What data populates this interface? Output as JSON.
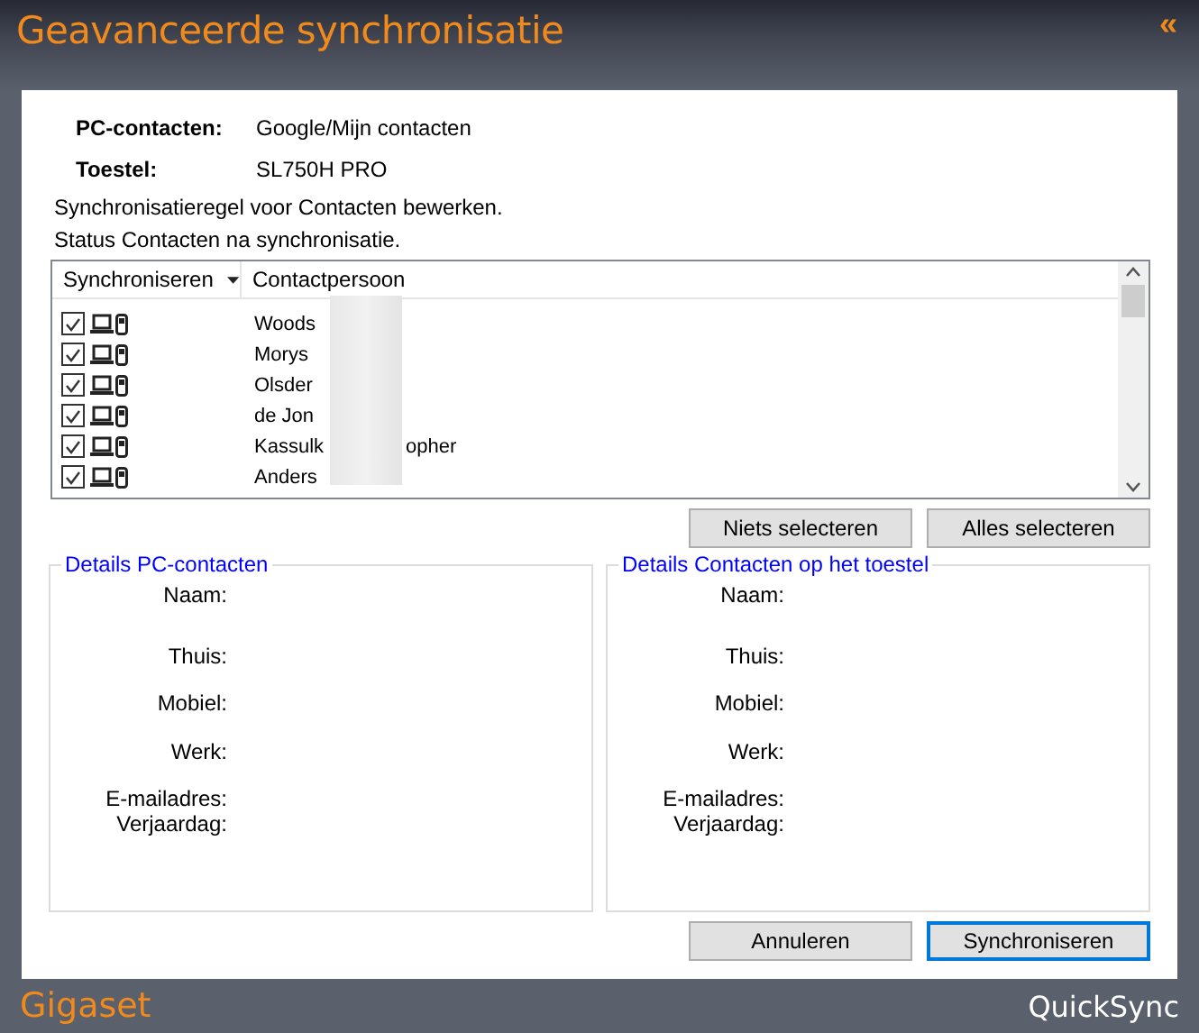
{
  "window": {
    "title": "Geavanceerde synchronisatie",
    "collapse": "«"
  },
  "info": [
    {
      "label": "PC-contacten:",
      "value": "Google/Mijn contacten"
    },
    {
      "label": "Toestel:",
      "value": "SL750H PRO"
    }
  ],
  "notes": [
    "Synchronisatieregel voor Contacten bewerken.",
    "Status Contacten na synchronisatie."
  ],
  "list": {
    "columns": [
      "Synchroniseren",
      "Contactpersoon"
    ],
    "rows": [
      {
        "checked": true,
        "name": "Woods"
      },
      {
        "checked": true,
        "name": "Morys"
      },
      {
        "checked": true,
        "name": "Olsder"
      },
      {
        "checked": true,
        "name": "de Jon"
      },
      {
        "checked": true,
        "name": "Kassulk",
        "tail": "opher"
      },
      {
        "checked": true,
        "name": "Anders"
      }
    ]
  },
  "list_buttons": [
    "Niets selecteren",
    "Alles selecteren"
  ],
  "details": [
    {
      "title": "Details PC-contacten",
      "fields": [
        "Naam:",
        "Thuis:",
        "Mobiel:",
        "Werk:",
        "E-mailadres:",
        "Verjaardag:"
      ]
    },
    {
      "title": "Details Contacten op het toestel",
      "fields": [
        "Naam:",
        "Thuis:",
        "Mobiel:",
        "Werk:",
        "E-mailadres:",
        "Verjaardag:"
      ]
    }
  ],
  "buttons": [
    {
      "label": "Annuleren",
      "default": false
    },
    {
      "label": "Synchroniseren",
      "default": true
    }
  ],
  "footer": {
    "brand": "Gigaset",
    "product": "QuickSync"
  }
}
